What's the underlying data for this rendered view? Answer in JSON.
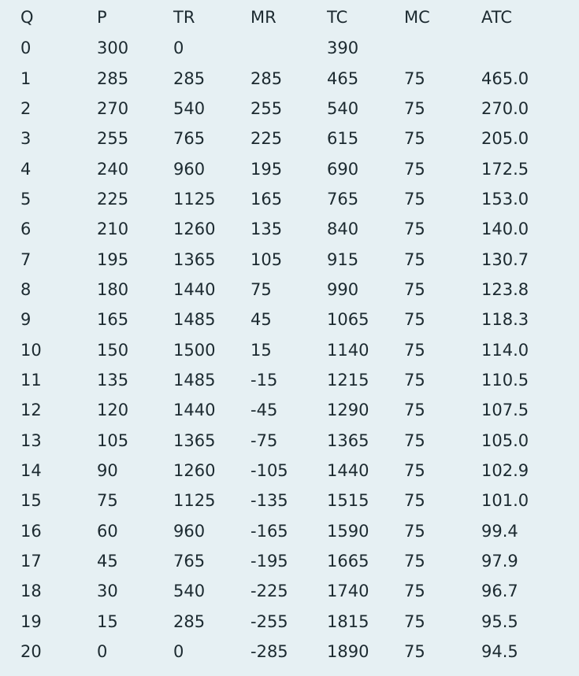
{
  "table": {
    "headers": [
      "Q",
      "P",
      "TR",
      "MR",
      "TC",
      "MC",
      "ATC"
    ],
    "rows": [
      [
        "0",
        "300",
        "0",
        "",
        "390",
        "",
        ""
      ],
      [
        "1",
        "285",
        "285",
        "285",
        "465",
        "75",
        "465.0"
      ],
      [
        "2",
        "270",
        "540",
        "255",
        "540",
        "75",
        "270.0"
      ],
      [
        "3",
        "255",
        "765",
        "225",
        "615",
        "75",
        "205.0"
      ],
      [
        "4",
        "240",
        "960",
        "195",
        "690",
        "75",
        "172.5"
      ],
      [
        "5",
        "225",
        "1125",
        "165",
        "765",
        "75",
        "153.0"
      ],
      [
        "6",
        "210",
        "1260",
        "135",
        "840",
        "75",
        "140.0"
      ],
      [
        "7",
        "195",
        "1365",
        "105",
        "915",
        "75",
        "130.7"
      ],
      [
        "8",
        "180",
        "1440",
        "75",
        "990",
        "75",
        "123.8"
      ],
      [
        "9",
        "165",
        "1485",
        "45",
        "1065",
        "75",
        "118.3"
      ],
      [
        "10",
        "150",
        "1500",
        "15",
        "1140",
        "75",
        "114.0"
      ],
      [
        "11",
        "135",
        "1485",
        "-15",
        "1215",
        "75",
        "110.5"
      ],
      [
        "12",
        "120",
        "1440",
        "-45",
        "1290",
        "75",
        "107.5"
      ],
      [
        "13",
        "105",
        "1365",
        "-75",
        "1365",
        "75",
        "105.0"
      ],
      [
        "14",
        "90",
        "1260",
        "-105",
        "1440",
        "75",
        "102.9"
      ],
      [
        "15",
        "75",
        "1125",
        "-135",
        "1515",
        "75",
        "101.0"
      ],
      [
        "16",
        "60",
        "960",
        "-165",
        "1590",
        "75",
        "99.4"
      ],
      [
        "17",
        "45",
        "765",
        "-195",
        "1665",
        "75",
        "97.9"
      ],
      [
        "18",
        "30",
        "540",
        "-225",
        "1740",
        "75",
        "96.7"
      ],
      [
        "19",
        "15",
        "285",
        "-255",
        "1815",
        "75",
        "95.5"
      ],
      [
        "20",
        "0",
        "0",
        "-285",
        "1890",
        "75",
        "94.5"
      ]
    ]
  }
}
